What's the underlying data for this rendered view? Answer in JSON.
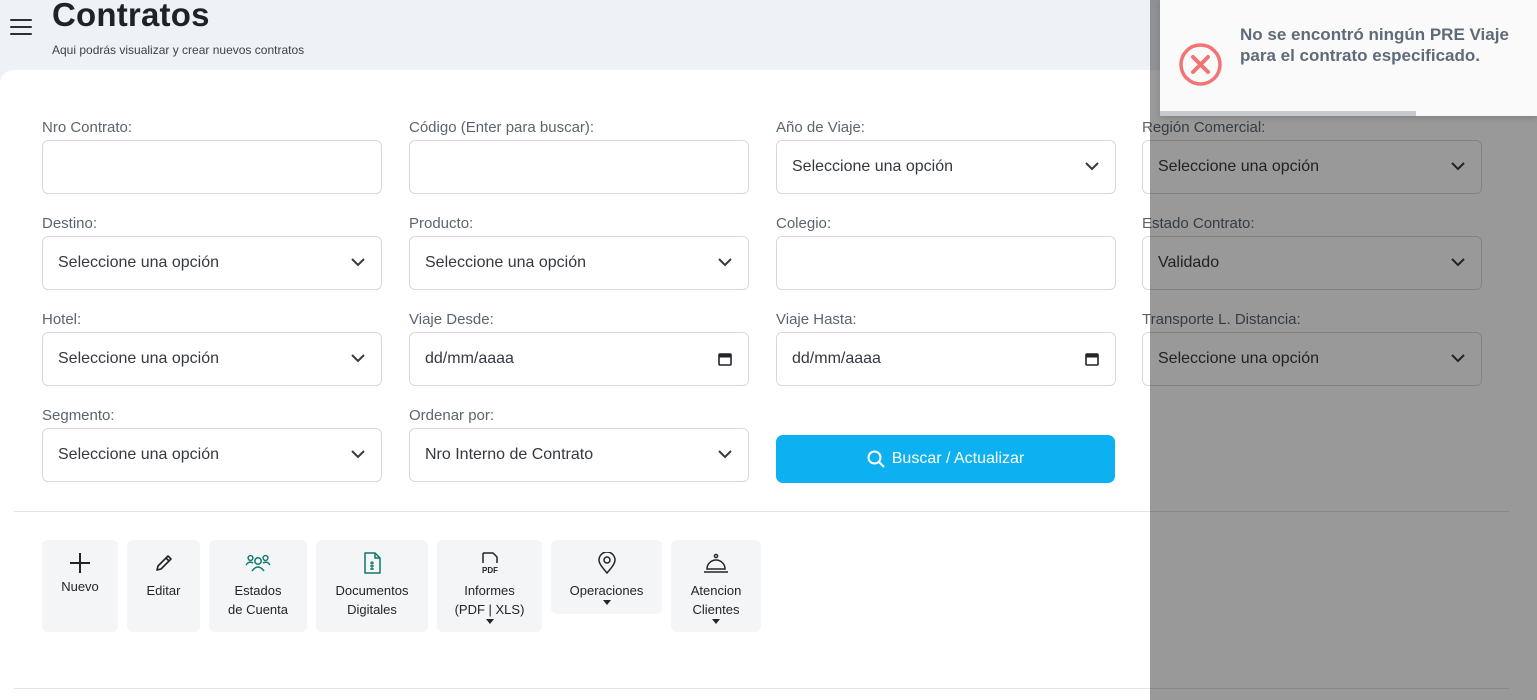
{
  "header": {
    "title": "Contratos",
    "subtitle": "Aqui podrás visualizar y crear nuevos contratos"
  },
  "filters": {
    "nro_contrato": {
      "label": "Nro Contrato:",
      "value": ""
    },
    "codigo": {
      "label": "Código (Enter para buscar):",
      "value": ""
    },
    "anio_viaje": {
      "label": "Año de Viaje:",
      "value": "Seleccione una opción"
    },
    "region_comercial": {
      "label": "Región Comercial:",
      "value": "Seleccione una opción"
    },
    "destino": {
      "label": "Destino:",
      "value": "Seleccione una opción"
    },
    "producto": {
      "label": "Producto:",
      "value": "Seleccione una opción"
    },
    "colegio": {
      "label": "Colegio:",
      "value": ""
    },
    "estado_contrato": {
      "label": "Estado Contrato:",
      "value": "Validado"
    },
    "hotel": {
      "label": "Hotel:",
      "value": "Seleccione una opción"
    },
    "viaje_desde": {
      "label": "Viaje Desde:",
      "value": "dd/mm/aaaa"
    },
    "viaje_hasta": {
      "label": "Viaje Hasta:",
      "value": "dd/mm/aaaa"
    },
    "transporte": {
      "label": "Transporte L. Distancia:",
      "value": "Seleccione una opción"
    },
    "segmento": {
      "label": "Segmento:",
      "value": "Seleccione una opción"
    },
    "ordenar_por": {
      "label": "Ordenar por:",
      "value": "Nro Interno de Contrato"
    }
  },
  "search_button": {
    "label": "Buscar / Actualizar"
  },
  "toolbar": {
    "nuevo": "Nuevo",
    "editar": "Editar",
    "estados_1": "Estados",
    "estados_2": "de Cuenta",
    "documentos_1": "Documentos",
    "documentos_2": "Digitales",
    "informes_1": "Informes",
    "informes_2": "(PDF | XLS)",
    "pdf_glyph": "PDF",
    "operaciones": "Operaciones",
    "atencion_1": "Atencion",
    "atencion_2": "Clientes"
  },
  "toast": {
    "message": "No se encontró ningún PRE Viaje para el contrato especificado.",
    "progress_fraction": 0.68
  },
  "colors": {
    "primary": "#0db0f0",
    "error": "#f27474",
    "overlay": "rgba(0,0,0,0.40)",
    "icon_green": "#0f766e"
  }
}
